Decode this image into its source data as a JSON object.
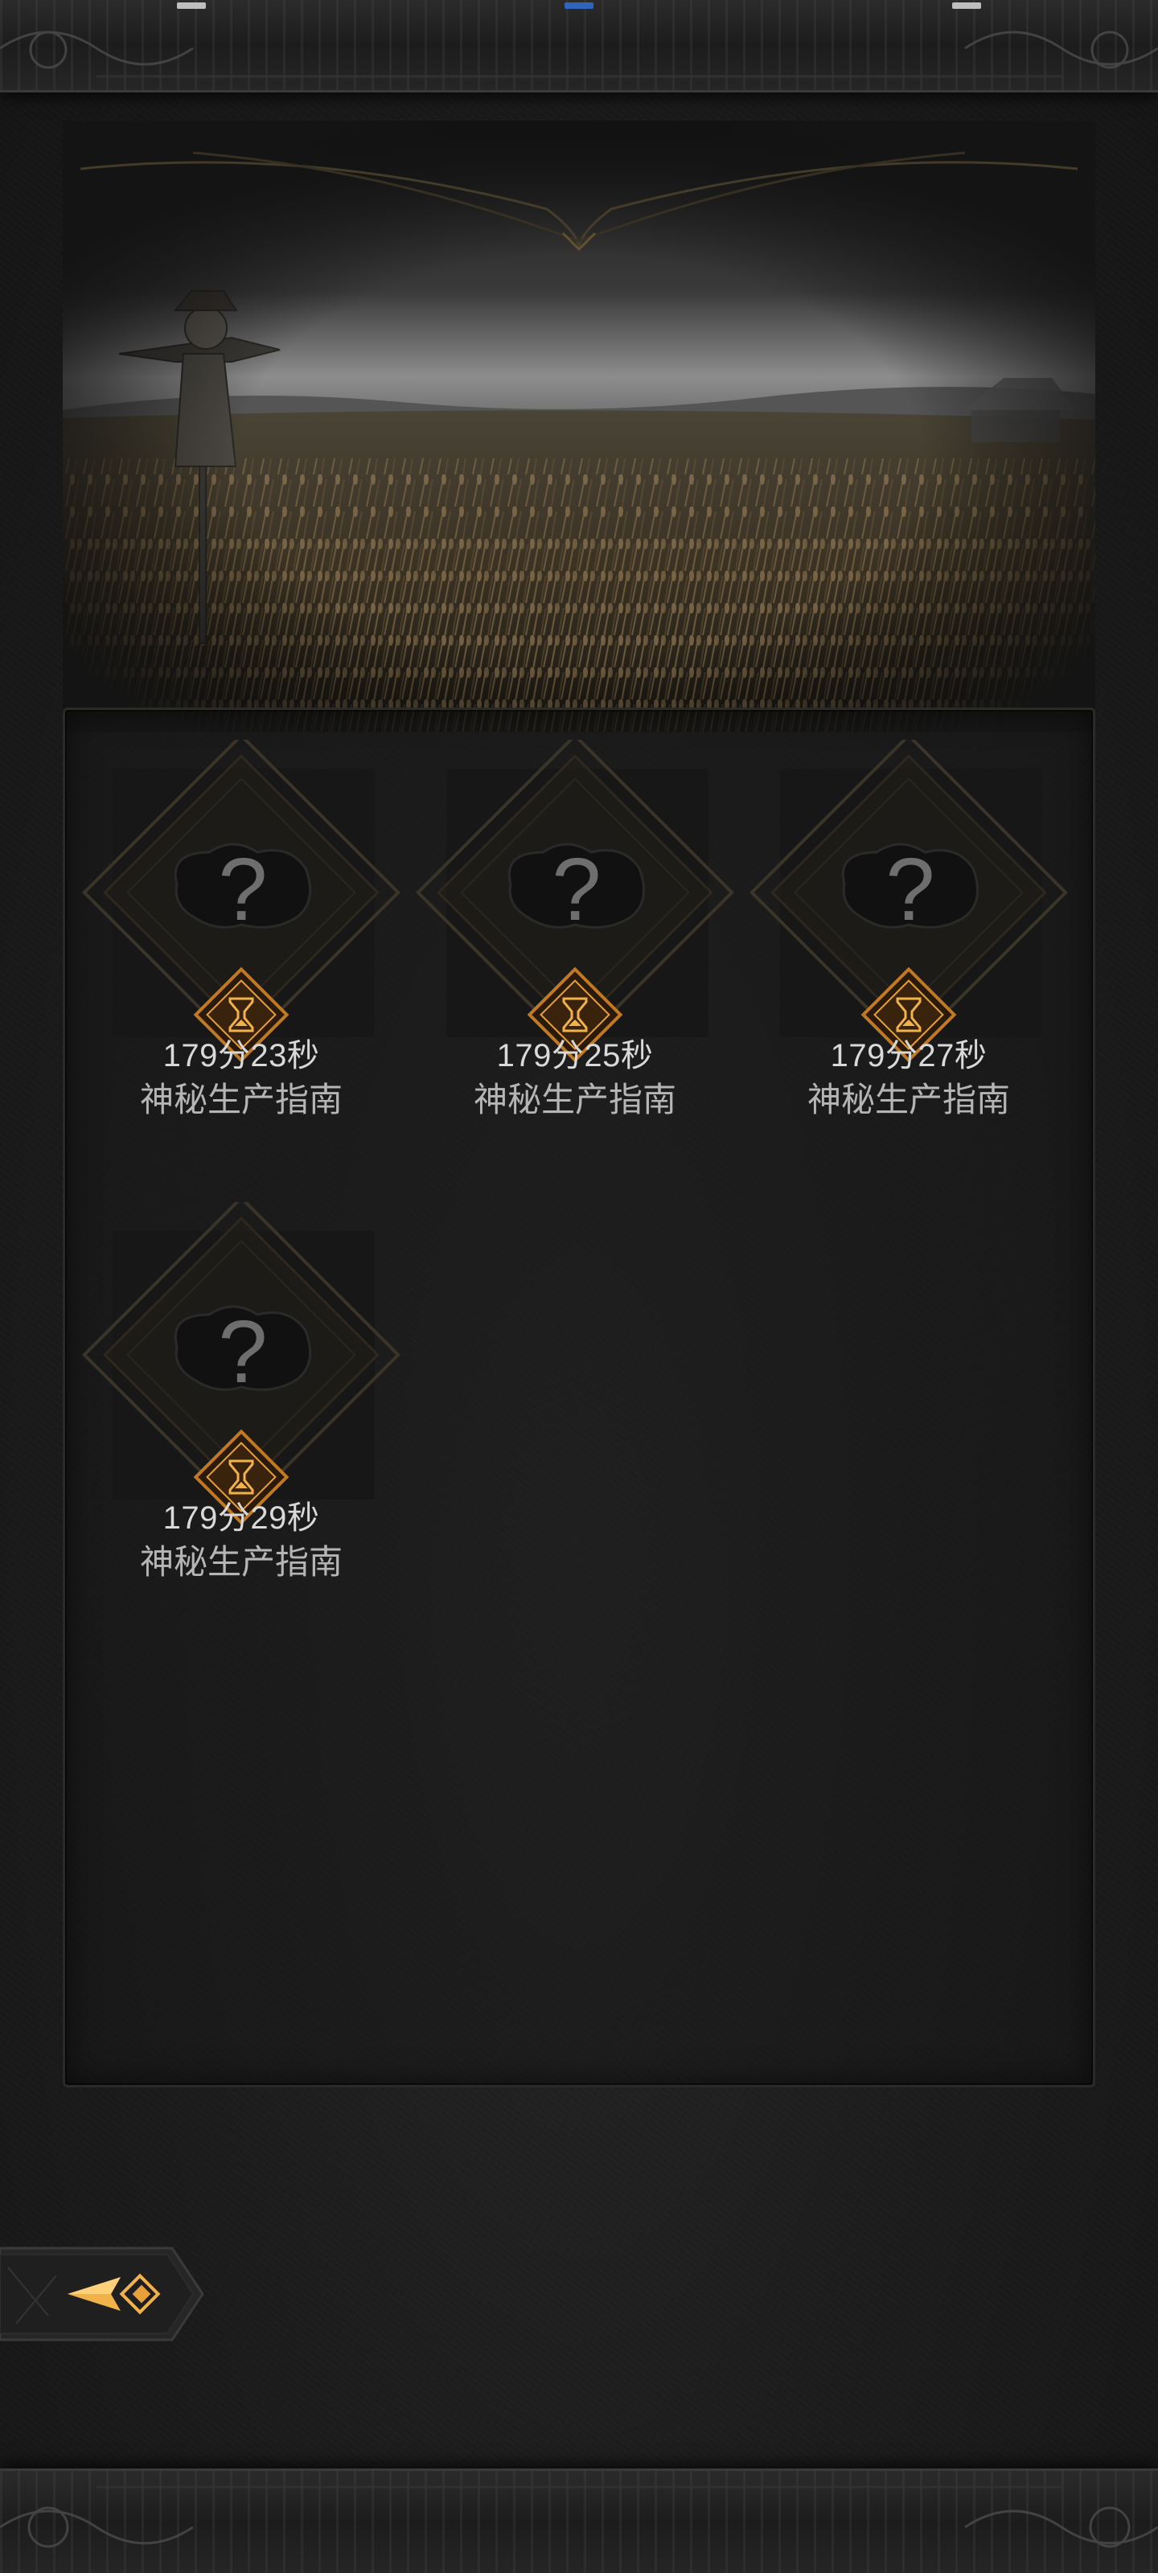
{
  "screen": {
    "cards": [
      {
        "timer": "179分23秒",
        "name": "神秘生产指南",
        "unknown_mark": "?"
      },
      {
        "timer": "179分25秒",
        "name": "神秘生产指南",
        "unknown_mark": "?"
      },
      {
        "timer": "179分27秒",
        "name": "神秘生产指南",
        "unknown_mark": "?"
      },
      {
        "timer": "179分29秒",
        "name": "神秘生产指南",
        "unknown_mark": "?"
      }
    ],
    "icons": {
      "card_badge": "hourglass-icon",
      "back": "arrow-left-icon",
      "banner": "scarecrow-wheatfield-illustration"
    },
    "colors": {
      "accent": "#e8a038",
      "frame": "#4a3f2c",
      "text_primary": "#d9d9d9",
      "text_secondary": "#b5b5b5"
    }
  }
}
